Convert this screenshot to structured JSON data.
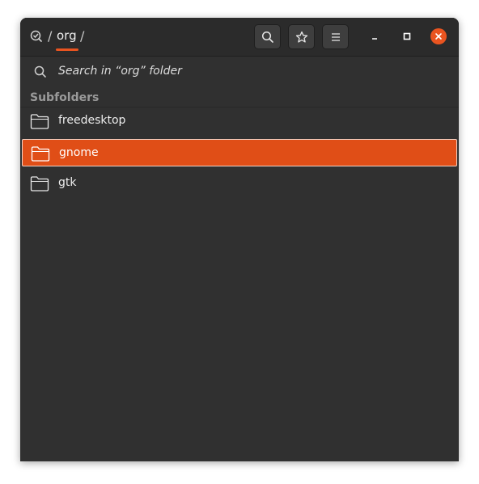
{
  "headerbar": {
    "path_separator": "/",
    "current_folder": "org",
    "buttons": {
      "search": "search-icon",
      "bookmark": "star-icon",
      "menu": "hamburger-menu-icon"
    },
    "window_controls": [
      "minimize-icon",
      "maximize-icon",
      "close-icon"
    ]
  },
  "search": {
    "text": "Search in “org” folder"
  },
  "subfolders": {
    "title": "Subfolders",
    "items": [
      {
        "label": "freedesktop",
        "selected": false
      },
      {
        "label": "gnome",
        "selected": true
      },
      {
        "label": "gtk",
        "selected": false
      }
    ]
  },
  "colors": {
    "accent": "#e95420",
    "background": "#303030",
    "header": "#2b2b2b"
  }
}
